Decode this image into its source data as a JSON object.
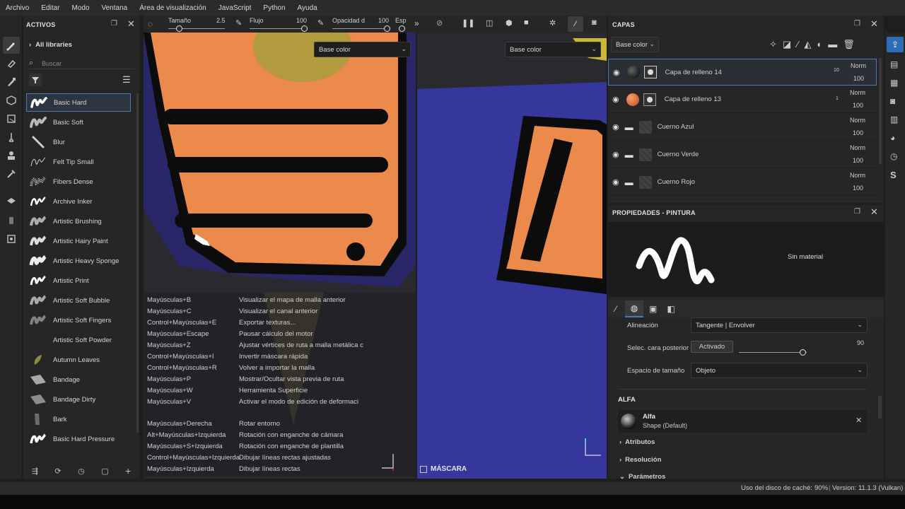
{
  "menu": [
    "Archivo",
    "Editar",
    "Modo",
    "Ventana",
    "Área de visualización",
    "JavaScript",
    "Python",
    "Ayuda"
  ],
  "assets_panel": {
    "title": "ACTIVOS",
    "library": "All libraries",
    "search_placeholder": "Buscar",
    "brushes": [
      "Basic Hard",
      "Basic Soft",
      "Blur",
      "Felt Tip Small",
      "Fibers Dense",
      "Archive Inker",
      "Artistic Brushing",
      "Artistic Hairy Paint",
      "Artistic Heavy Sponge",
      "Artistic Print",
      "Artistic Soft Bubble",
      "Artistic Soft Fingers",
      "Artistic Soft Powder",
      "Autumn Leaves",
      "Bandage",
      "Bandage Dirty",
      "Bark",
      "Basic Hard Pressure"
    ],
    "selected_brush": "Basic Hard"
  },
  "brush_bar": {
    "size_label": "Tamaño",
    "size_value": "2.5",
    "flow_label": "Flujo",
    "flow_value": "100",
    "opacity_label": "Opacidad d",
    "opacity_value": "100",
    "spacing_label": "Esp"
  },
  "viewport": {
    "left_channel": "Base color",
    "right_channel": "Base color",
    "mask_label": "MÁSCARA"
  },
  "shortcuts": [
    {
      "keys": "Mayúsculas+B",
      "action": "Visualizar el mapa de malla anterior"
    },
    {
      "keys": "Mayúsculas+C",
      "action": "Visualizar el canal anterior"
    },
    {
      "keys": "Control+Mayúsculas+E",
      "action": "Exportar texturas..."
    },
    {
      "keys": "Mayúsculas+Escape",
      "action": "Pausar cálculo del motor"
    },
    {
      "keys": "Mayúsculas+Z",
      "action": "Ajustar vértices de ruta a malla metálica c"
    },
    {
      "keys": "Control+Mayúsculas+I",
      "action": "Invertir máscara rápida"
    },
    {
      "keys": "Control+Mayúsculas+R",
      "action": "Volver a importar la malla"
    },
    {
      "keys": "Mayúsculas+P",
      "action": "Mostrar/Ocultar vista previa de ruta"
    },
    {
      "keys": "Mayúsculas+W",
      "action": "Herramienta Superficie"
    },
    {
      "keys": "Mayúsculas+V",
      "action": "Activar el modo de edición de deformaci"
    },
    {
      "keys": "Mayúsculas+Derecha",
      "action": "Rotar entorno"
    },
    {
      "keys": "Alt+Mayúsculas+Izquierda",
      "action": "Rotación con enganche de cámara"
    },
    {
      "keys": "Mayúsculas+S+Izquierda",
      "action": "Rotación con enganche de plantilla"
    },
    {
      "keys": "Control+Mayúsculas+Izquierda",
      "action": "Dibujar líneas rectas ajustadas"
    },
    {
      "keys": "Mayúsculas+Izquierda",
      "action": "Dibujar líneas rectas"
    }
  ],
  "layers_panel": {
    "title": "CAPAS",
    "channel": "Base color",
    "layers": [
      {
        "name": "Capa de relleno 14",
        "blend": "Norm",
        "opacity": "100",
        "badge": "10"
      },
      {
        "name": "Capa de relleno 13",
        "blend": "Norm",
        "opacity": "100",
        "badge": "1"
      },
      {
        "name": "Cuerno Azul",
        "blend": "Norm",
        "opacity": "100"
      },
      {
        "name": "Cuerno Verde",
        "blend": "Norm",
        "opacity": "100"
      },
      {
        "name": "Cuerno Rojo",
        "blend": "Norm",
        "opacity": "100"
      }
    ]
  },
  "properties_panel": {
    "title": "PROPIEDADES - PINTURA",
    "material": "Sin material",
    "alignment_label": "Alineación",
    "alignment_value": "Tangente | Envolver",
    "backface_label": "Selec. cara posterior",
    "backface_button": "Activado",
    "backface_value": "90",
    "size_space_label": "Espacio de tamaño",
    "size_space_value": "Objeto",
    "alpha_section": "ALFA",
    "alpha_name": "Alfa",
    "alpha_shape": "Shape (Default)",
    "sections": [
      "Atributos",
      "Resolución",
      "Parámetros"
    ]
  },
  "status": {
    "cache_label": "Uso del disco de caché:",
    "cache_value": "90%",
    "version": "Version: 11.1.3 (Vulkan)"
  },
  "colors": {
    "accent": "#4a79b5",
    "orange": "#ea8a4a",
    "navy": "#2e2a7c",
    "yellow": "#b99a3a"
  }
}
